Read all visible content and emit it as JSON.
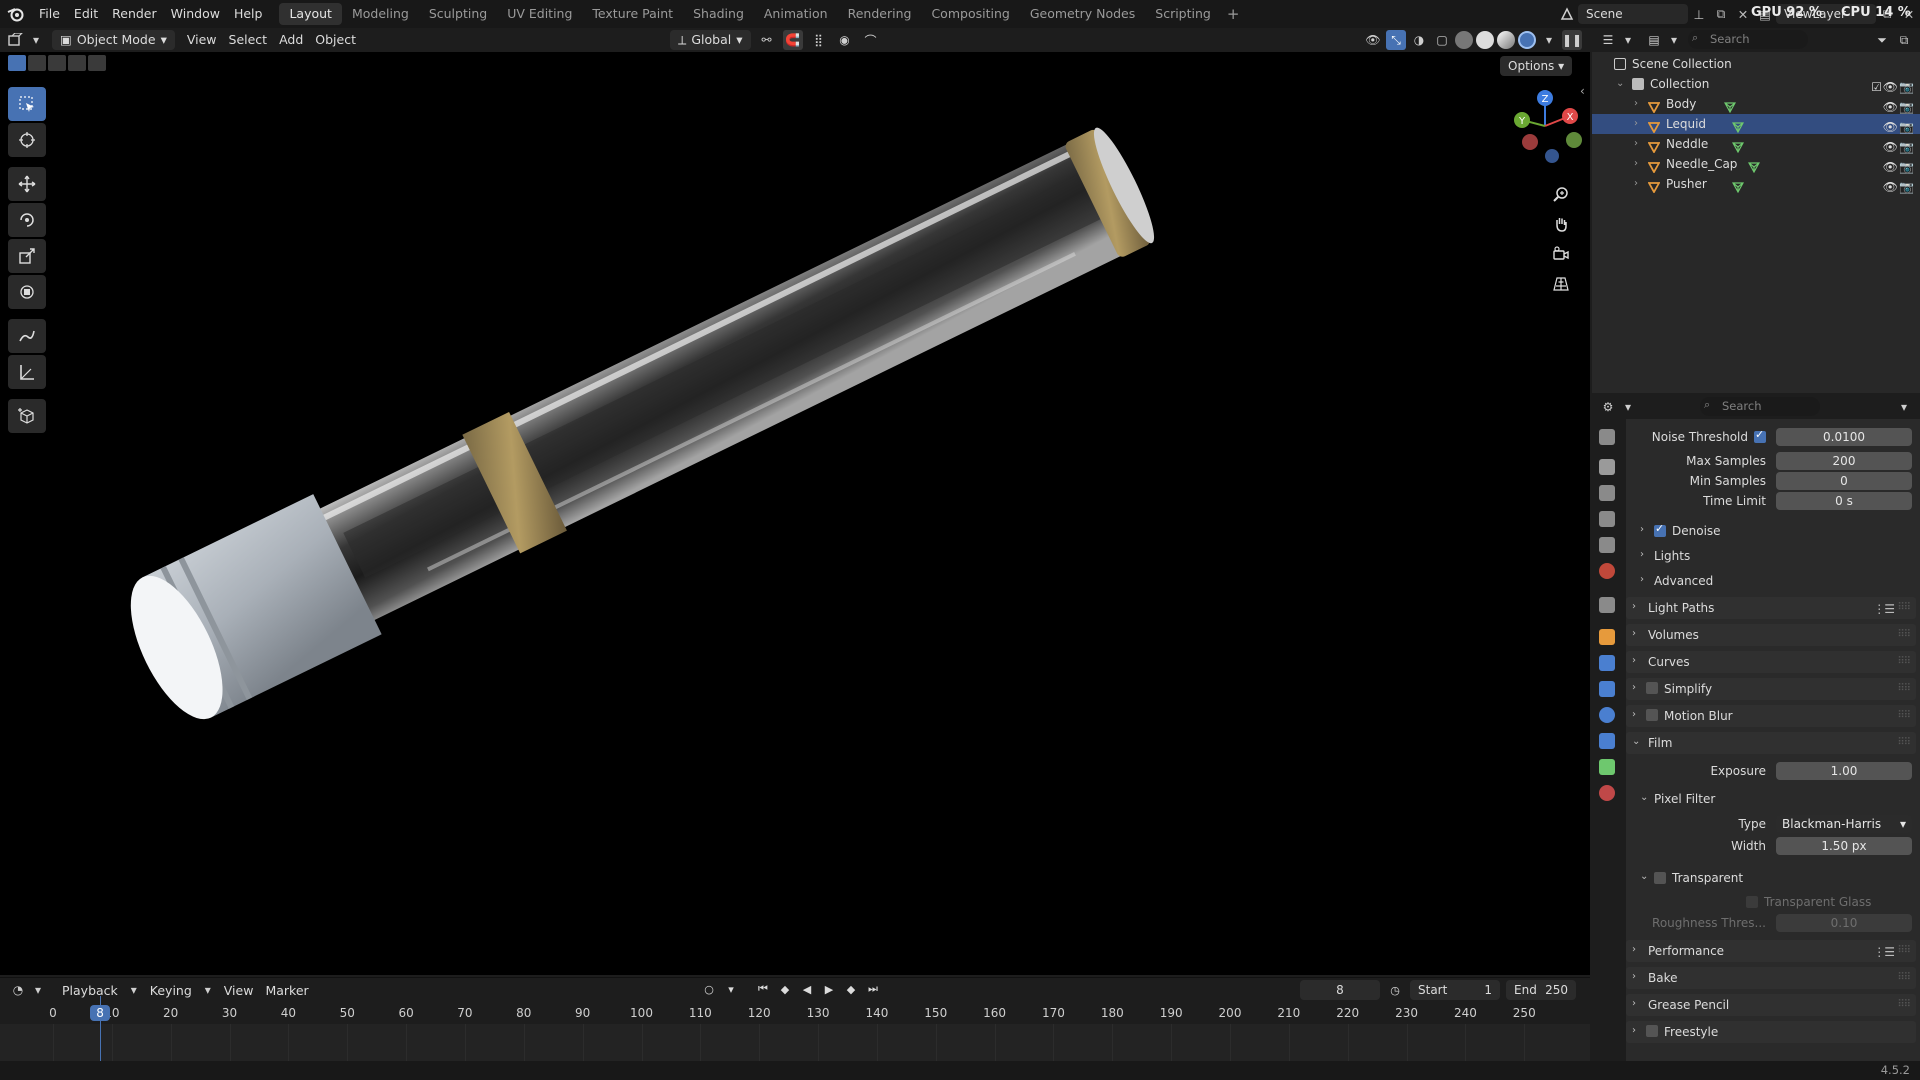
{
  "menu": {
    "items": [
      "File",
      "Edit",
      "Render",
      "Window",
      "Help"
    ]
  },
  "workspaces": {
    "tabs": [
      "Layout",
      "Modeling",
      "Sculpting",
      "UV Editing",
      "Texture Paint",
      "Shading",
      "Animation",
      "Rendering",
      "Compositing",
      "Geometry Nodes",
      "Scripting"
    ],
    "active": "Layout"
  },
  "top_right": {
    "scene": "Scene",
    "view_layer": "ViewLayer",
    "gpu": "GPU 92 %",
    "cpu": "CPU 14 %"
  },
  "viewport_header": {
    "mode": "Object Mode",
    "menus": [
      "View",
      "Select",
      "Add",
      "Object"
    ],
    "orientation": "Global"
  },
  "viewport": {
    "options_label": "Options"
  },
  "gizmo": {
    "axes": [
      "X",
      "Y",
      "Z"
    ],
    "colors": {
      "x": "#e04848",
      "y": "#6aa832",
      "z": "#3d7ce0"
    }
  },
  "timeline": {
    "menus": [
      "Playback",
      "Keying",
      "View",
      "Marker"
    ],
    "current_frame": "8",
    "start_label": "Start",
    "start_value": "1",
    "end_label": "End",
    "end_value": "250",
    "ticks": [
      "0",
      "10",
      "20",
      "30",
      "40",
      "50",
      "60",
      "70",
      "80",
      "90",
      "100",
      "110",
      "120",
      "130",
      "140",
      "150",
      "160",
      "170",
      "180",
      "190",
      "200",
      "210",
      "220",
      "230",
      "240",
      "250"
    ]
  },
  "outliner": {
    "search_placeholder": "Search",
    "root": "Scene Collection",
    "collection": "Collection",
    "objects": [
      "Body",
      "Lequid",
      "Neddle",
      "Needle_Cap",
      "Pusher"
    ],
    "selected": "Lequid"
  },
  "properties": {
    "search_placeholder": "Search",
    "noise_threshold_label": "Noise Threshold",
    "noise_threshold_value": "0.0100",
    "max_samples_label": "Max Samples",
    "max_samples_value": "200",
    "min_samples_label": "Min Samples",
    "min_samples_value": "0",
    "time_limit_label": "Time Limit",
    "time_limit_value": "0 s",
    "denoise_label": "Denoise",
    "lights_label": "Lights",
    "advanced_label": "Advanced",
    "sections": [
      "Light Paths",
      "Volumes",
      "Curves",
      "Simplify",
      "Motion Blur",
      "Film"
    ],
    "exposure_label": "Exposure",
    "exposure_value": "1.00",
    "pixel_filter_label": "Pixel Filter",
    "type_label": "Type",
    "type_value": "Blackman-Harris",
    "width_label": "Width",
    "width_value": "1.50 px",
    "transparent_label": "Transparent",
    "transparent_glass_label": "Transparent Glass",
    "roughness_label": "Roughness Thres...",
    "roughness_value": "0.10",
    "sections_after": [
      "Performance",
      "Bake",
      "Grease Pencil"
    ],
    "partial_section": "Freestyle"
  },
  "status": {
    "version": "4.5.2"
  },
  "colors": {
    "accent": "#4772b3",
    "selection": "#334d80",
    "object_icon": "#e69a3c",
    "mesh_data": "#6ec86e"
  }
}
